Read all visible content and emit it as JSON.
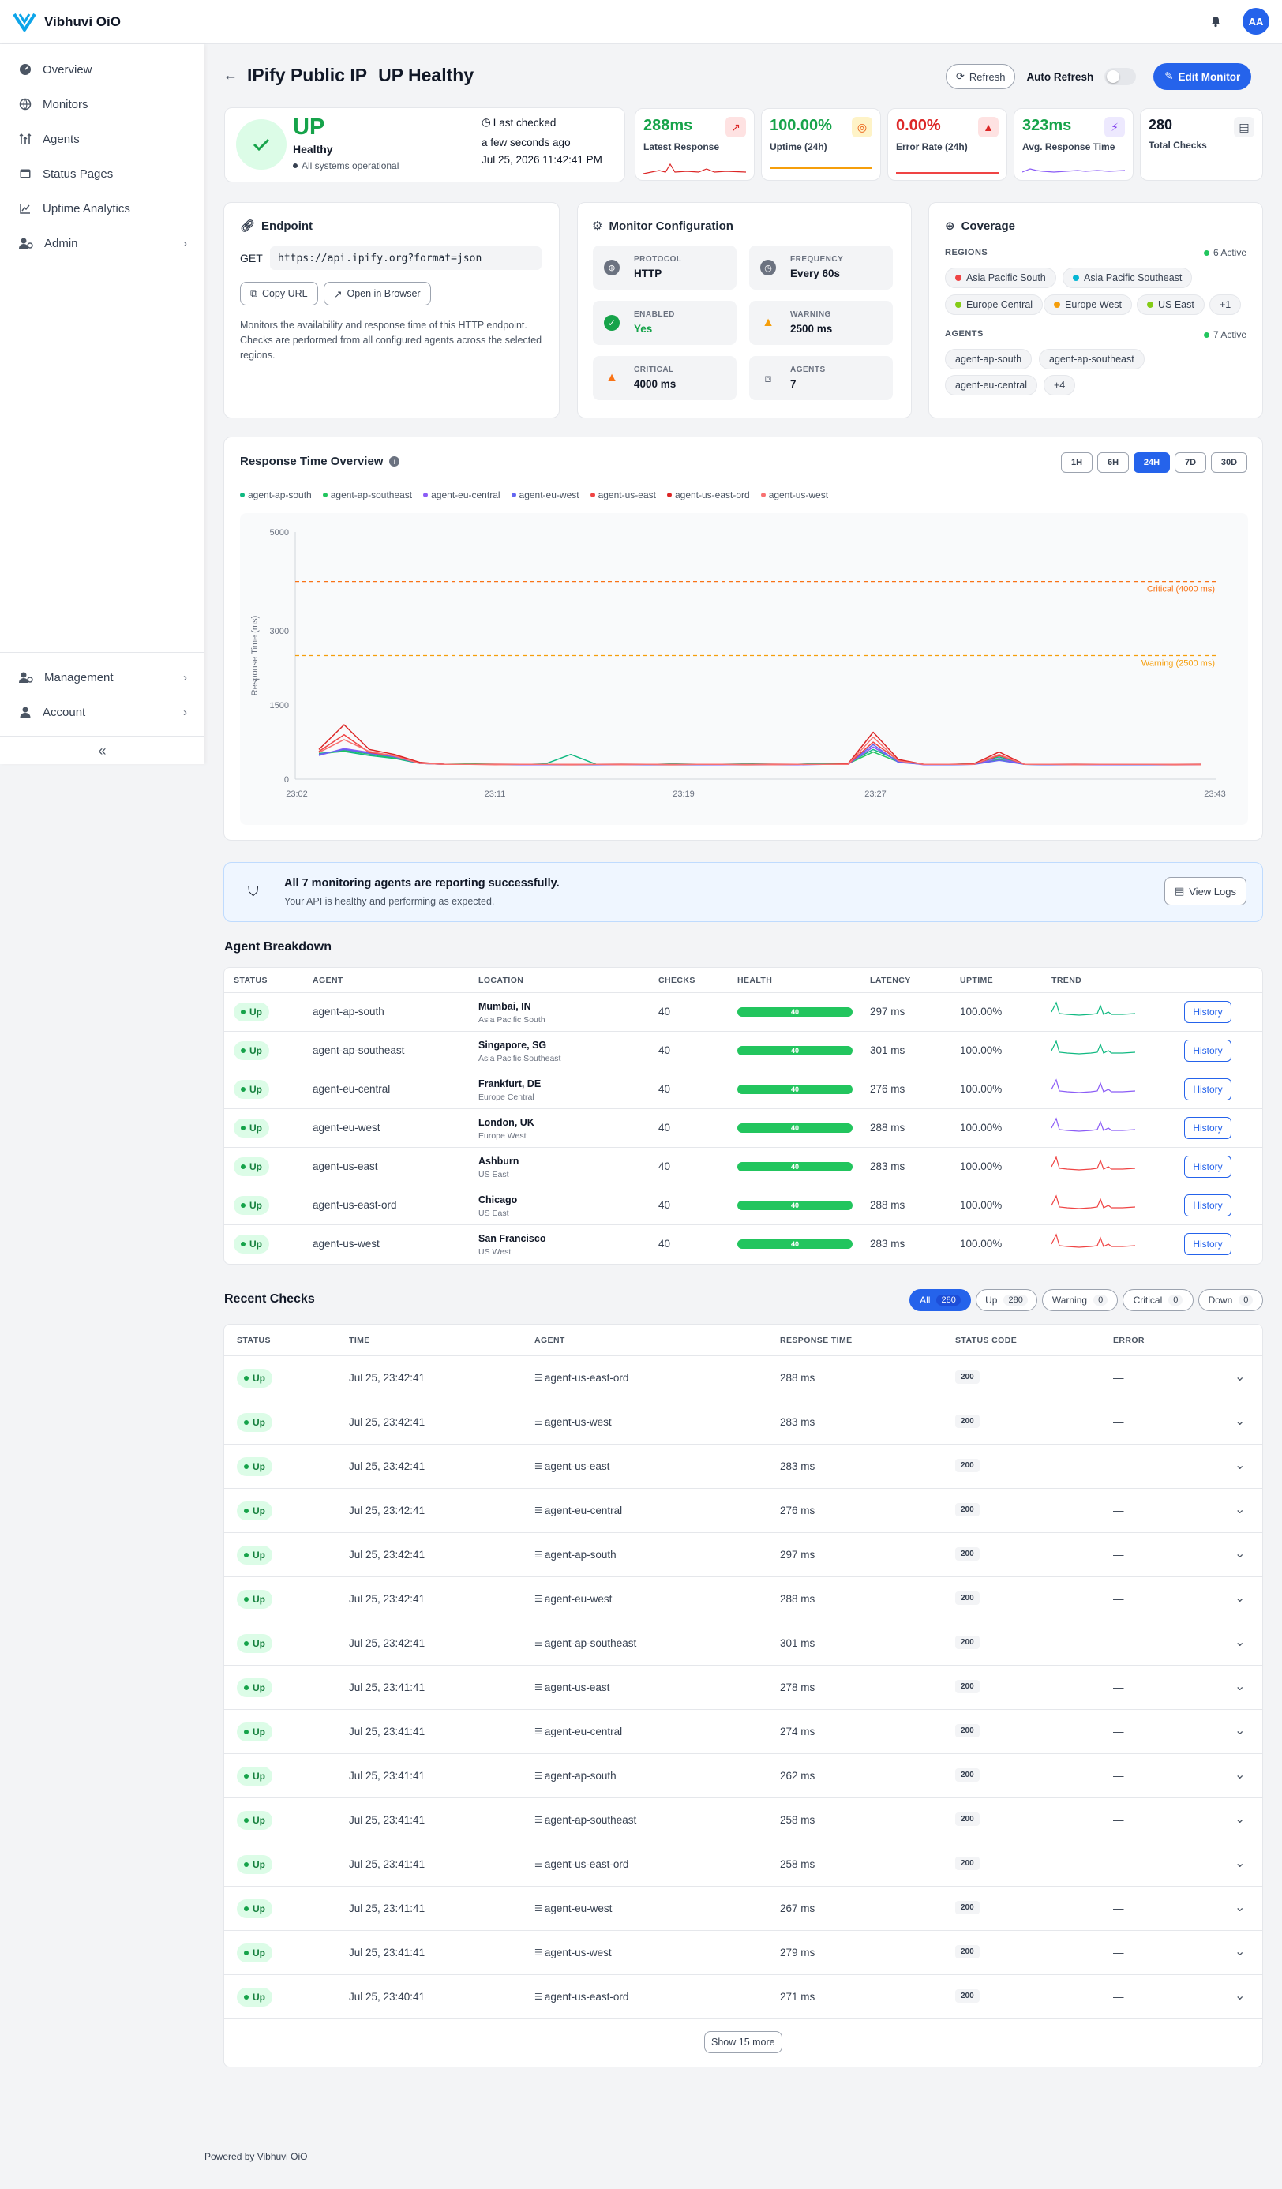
{
  "app": {
    "name": "Vibhuvi OiO",
    "avatar_initials": "AA",
    "accent": "#2563eb"
  },
  "sidebar": {
    "items": [
      {
        "label": "Overview",
        "icon": "gauge-icon"
      },
      {
        "label": "Monitors",
        "icon": "globe-icon"
      },
      {
        "label": "Agents",
        "icon": "antenna-icon"
      },
      {
        "label": "Status Pages",
        "icon": "browser-icon"
      },
      {
        "label": "Uptime Analytics",
        "icon": "chart-icon"
      },
      {
        "label": "Admin",
        "icon": "user-gear-icon"
      }
    ],
    "bottom_items": [
      {
        "label": "Management",
        "icon": "user-gear-icon"
      },
      {
        "label": "Account",
        "icon": "user-icon"
      }
    ]
  },
  "header": {
    "title": "IPify Public IP",
    "status_title": "UP Healthy",
    "refresh_label": "Refresh",
    "auto_refresh_label": "Auto Refresh",
    "edit_label": "Edit Monitor"
  },
  "status_card": {
    "status": "UP",
    "health": "Healthy",
    "sub": "All systems operational",
    "last_checked_label": "Last checked",
    "last_checked_rel": "a few seconds ago",
    "last_checked_abs": "Jul 25, 2026 11:42:41 PM"
  },
  "stats": [
    {
      "value": "288ms",
      "label": "Latest Response",
      "color": "#16a34a"
    },
    {
      "value": "100.00%",
      "label": "Uptime (24h)",
      "color": "#16a34a"
    },
    {
      "value": "0.00%",
      "label": "Error Rate (24h)",
      "color": "#dc2626"
    },
    {
      "value": "323ms",
      "label": "Avg. Response Time",
      "color": "#16a34a"
    },
    {
      "value": "280",
      "label": "Total Checks",
      "color": "#111827"
    }
  ],
  "endpoint": {
    "title": "Endpoint",
    "method": "GET",
    "url": "https://api.ipify.org?format=json",
    "copy_label": "Copy URL",
    "open_label": "Open in Browser",
    "description": "Monitors the availability and response time of this HTTP endpoint. Checks are performed from all configured agents across the selected regions."
  },
  "config": {
    "title": "Monitor Configuration",
    "items": [
      {
        "key": "PROTOCOL",
        "value": "HTTP"
      },
      {
        "key": "FREQUENCY",
        "value": "Every 60s"
      },
      {
        "key": "ENABLED",
        "value": "Yes"
      },
      {
        "key": "WARNING",
        "value": "2500 ms"
      },
      {
        "key": "CRITICAL",
        "value": "4000 ms"
      },
      {
        "key": "AGENTS",
        "value": "7"
      }
    ]
  },
  "coverage": {
    "title": "Coverage",
    "regions_label": "REGIONS",
    "regions_active": "6 Active",
    "regions": [
      {
        "name": "Asia Pacific South",
        "color": "#ef4444"
      },
      {
        "name": "Asia Pacific Southeast",
        "color": "#06b6d4"
      },
      {
        "name": "Europe Central",
        "color": "#84cc16"
      },
      {
        "name": "Europe West",
        "color": "#f59e0b"
      },
      {
        "name": "US East",
        "color": "#84cc16"
      }
    ],
    "regions_more": "+1",
    "agents_label": "AGENTS",
    "agents_active": "7 Active",
    "agents": [
      "agent-ap-south",
      "agent-ap-southeast",
      "agent-eu-central"
    ],
    "agents_more": "+4"
  },
  "chart_card": {
    "title": "Response Time Overview",
    "ranges": [
      "1H",
      "6H",
      "24H",
      "7D",
      "30D"
    ],
    "active_range": "24H"
  },
  "chart_data": {
    "type": "line",
    "ylabel": "Response Time (ms)",
    "y_ticks": [
      0,
      1500,
      3000,
      5000
    ],
    "ylim": [
      0,
      5000
    ],
    "x_ticks": [
      "23:02",
      "23:11",
      "23:19",
      "23:27",
      "23:43"
    ],
    "thresholds": [
      {
        "label": "Critical (4000 ms)",
        "value": 4000,
        "color": "#f97316"
      },
      {
        "label": "Warning (2500 ms)",
        "value": 2500,
        "color": "#f59e0b"
      }
    ],
    "series": [
      {
        "name": "agent-ap-south",
        "color": "#10b981",
        "values": [
          520,
          560,
          480,
          420,
          320,
          300,
          300,
          300,
          290,
          310,
          500,
          300,
          300,
          290,
          310,
          300,
          300,
          310,
          300,
          300,
          320,
          320,
          600,
          380,
          300,
          290,
          320,
          450,
          300,
          290,
          300,
          300,
          300,
          300,
          290,
          300
        ]
      },
      {
        "name": "agent-ap-southeast",
        "color": "#22c55e",
        "values": [
          500,
          580,
          510,
          430,
          330,
          300,
          310,
          300,
          300,
          300,
          300,
          300,
          300,
          300,
          300,
          300,
          300,
          300,
          300,
          300,
          300,
          310,
          550,
          350,
          300,
          300,
          300,
          400,
          300,
          300,
          300,
          290,
          300,
          300,
          300,
          300
        ]
      },
      {
        "name": "agent-eu-central",
        "color": "#8b5cf6",
        "values": [
          480,
          620,
          540,
          460,
          320,
          300,
          300,
          300,
          290,
          290,
          290,
          290,
          290,
          290,
          290,
          290,
          290,
          300,
          290,
          290,
          300,
          300,
          650,
          360,
          290,
          290,
          300,
          420,
          300,
          290,
          290,
          290,
          290,
          290,
          290,
          290
        ]
      },
      {
        "name": "agent-eu-west",
        "color": "#6366f1",
        "values": [
          500,
          600,
          520,
          450,
          320,
          300,
          300,
          300,
          300,
          300,
          290,
          290,
          300,
          290,
          290,
          290,
          300,
          290,
          290,
          300,
          300,
          300,
          700,
          340,
          300,
          290,
          300,
          380,
          300,
          290,
          290,
          300,
          290,
          290,
          300,
          290
        ]
      },
      {
        "name": "agent-us-east",
        "color": "#ef4444",
        "values": [
          560,
          900,
          540,
          480,
          330,
          300,
          300,
          300,
          300,
          300,
          290,
          300,
          300,
          300,
          290,
          300,
          300,
          290,
          300,
          300,
          300,
          300,
          750,
          380,
          300,
          300,
          300,
          480,
          300,
          300,
          300,
          300,
          300,
          300,
          290,
          300
        ]
      },
      {
        "name": "agent-us-east-ord",
        "color": "#dc2626",
        "values": [
          600,
          1100,
          600,
          500,
          340,
          300,
          300,
          300,
          300,
          300,
          300,
          300,
          300,
          300,
          300,
          300,
          300,
          300,
          300,
          300,
          300,
          310,
          950,
          400,
          300,
          300,
          310,
          550,
          300,
          300,
          300,
          300,
          300,
          300,
          300,
          300
        ]
      },
      {
        "name": "agent-us-west",
        "color": "#f87171",
        "values": [
          540,
          800,
          560,
          470,
          320,
          300,
          300,
          290,
          300,
          300,
          300,
          300,
          290,
          300,
          300,
          300,
          300,
          300,
          290,
          300,
          300,
          300,
          850,
          370,
          300,
          300,
          300,
          500,
          300,
          300,
          290,
          300,
          300,
          300,
          300,
          290
        ]
      }
    ]
  },
  "alert": {
    "title": "All 7 monitoring agents are reporting successfully.",
    "sub": "Your API is healthy and performing as expected.",
    "button": "View Logs"
  },
  "agent_breakdown": {
    "title": "Agent Breakdown",
    "columns": [
      "STATUS",
      "AGENT",
      "LOCATION",
      "CHECKS",
      "HEALTH",
      "LATENCY",
      "UPTIME",
      "TREND"
    ],
    "history_label": "History",
    "rows": [
      {
        "status": "Up",
        "agent": "agent-ap-south",
        "city": "Mumbai, IN",
        "region": "Asia Pacific South",
        "checks": "40",
        "health": "40",
        "latency": "297 ms",
        "uptime": "100.00%",
        "trend_color": "#10b981"
      },
      {
        "status": "Up",
        "agent": "agent-ap-southeast",
        "city": "Singapore, SG",
        "region": "Asia Pacific Southeast",
        "checks": "40",
        "health": "40",
        "latency": "301 ms",
        "uptime": "100.00%",
        "trend_color": "#10b981"
      },
      {
        "status": "Up",
        "agent": "agent-eu-central",
        "city": "Frankfurt, DE",
        "region": "Europe Central",
        "checks": "40",
        "health": "40",
        "latency": "276 ms",
        "uptime": "100.00%",
        "trend_color": "#8b5cf6"
      },
      {
        "status": "Up",
        "agent": "agent-eu-west",
        "city": "London, UK",
        "region": "Europe West",
        "checks": "40",
        "health": "40",
        "latency": "288 ms",
        "uptime": "100.00%",
        "trend_color": "#8b5cf6"
      },
      {
        "status": "Up",
        "agent": "agent-us-east",
        "city": "Ashburn",
        "region": "US East",
        "checks": "40",
        "health": "40",
        "latency": "283 ms",
        "uptime": "100.00%",
        "trend_color": "#ef4444"
      },
      {
        "status": "Up",
        "agent": "agent-us-east-ord",
        "city": "Chicago",
        "region": "US East",
        "checks": "40",
        "health": "40",
        "latency": "288 ms",
        "uptime": "100.00%",
        "trend_color": "#ef4444"
      },
      {
        "status": "Up",
        "agent": "agent-us-west",
        "city": "San Francisco",
        "region": "US West",
        "checks": "40",
        "health": "40",
        "latency": "283 ms",
        "uptime": "100.00%",
        "trend_color": "#ef4444"
      }
    ]
  },
  "recent_checks": {
    "title": "Recent Checks",
    "filters": [
      {
        "label": "All",
        "count": "280"
      },
      {
        "label": "Up",
        "count": "280"
      },
      {
        "label": "Warning",
        "count": "0"
      },
      {
        "label": "Critical",
        "count": "0"
      },
      {
        "label": "Down",
        "count": "0"
      }
    ],
    "columns": [
      "STATUS",
      "TIME",
      "AGENT",
      "RESPONSE TIME",
      "STATUS CODE",
      "ERROR"
    ],
    "rows": [
      {
        "status": "Up",
        "time": "Jul 25, 23:42:41",
        "agent": "agent-us-east-ord",
        "rt": "288 ms",
        "code": "200",
        "error": "—"
      },
      {
        "status": "Up",
        "time": "Jul 25, 23:42:41",
        "agent": "agent-us-west",
        "rt": "283 ms",
        "code": "200",
        "error": "—"
      },
      {
        "status": "Up",
        "time": "Jul 25, 23:42:41",
        "agent": "agent-us-east",
        "rt": "283 ms",
        "code": "200",
        "error": "—"
      },
      {
        "status": "Up",
        "time": "Jul 25, 23:42:41",
        "agent": "agent-eu-central",
        "rt": "276 ms",
        "code": "200",
        "error": "—"
      },
      {
        "status": "Up",
        "time": "Jul 25, 23:42:41",
        "agent": "agent-ap-south",
        "rt": "297 ms",
        "code": "200",
        "error": "—"
      },
      {
        "status": "Up",
        "time": "Jul 25, 23:42:41",
        "agent": "agent-eu-west",
        "rt": "288 ms",
        "code": "200",
        "error": "—"
      },
      {
        "status": "Up",
        "time": "Jul 25, 23:42:41",
        "agent": "agent-ap-southeast",
        "rt": "301 ms",
        "code": "200",
        "error": "—"
      },
      {
        "status": "Up",
        "time": "Jul 25, 23:41:41",
        "agent": "agent-us-east",
        "rt": "278 ms",
        "code": "200",
        "error": "—"
      },
      {
        "status": "Up",
        "time": "Jul 25, 23:41:41",
        "agent": "agent-eu-central",
        "rt": "274 ms",
        "code": "200",
        "error": "—"
      },
      {
        "status": "Up",
        "time": "Jul 25, 23:41:41",
        "agent": "agent-ap-south",
        "rt": "262 ms",
        "code": "200",
        "error": "—"
      },
      {
        "status": "Up",
        "time": "Jul 25, 23:41:41",
        "agent": "agent-ap-southeast",
        "rt": "258 ms",
        "code": "200",
        "error": "—"
      },
      {
        "status": "Up",
        "time": "Jul 25, 23:41:41",
        "agent": "agent-us-east-ord",
        "rt": "258 ms",
        "code": "200",
        "error": "—"
      },
      {
        "status": "Up",
        "time": "Jul 25, 23:41:41",
        "agent": "agent-eu-west",
        "rt": "267 ms",
        "code": "200",
        "error": "—"
      },
      {
        "status": "Up",
        "time": "Jul 25, 23:41:41",
        "agent": "agent-us-west",
        "rt": "279 ms",
        "code": "200",
        "error": "—"
      },
      {
        "status": "Up",
        "time": "Jul 25, 23:40:41",
        "agent": "agent-us-east-ord",
        "rt": "271 ms",
        "code": "200",
        "error": "—"
      }
    ],
    "show_more": "Show 15 more"
  },
  "footer": {
    "text": "Powered by Vibhuvi OiO"
  }
}
